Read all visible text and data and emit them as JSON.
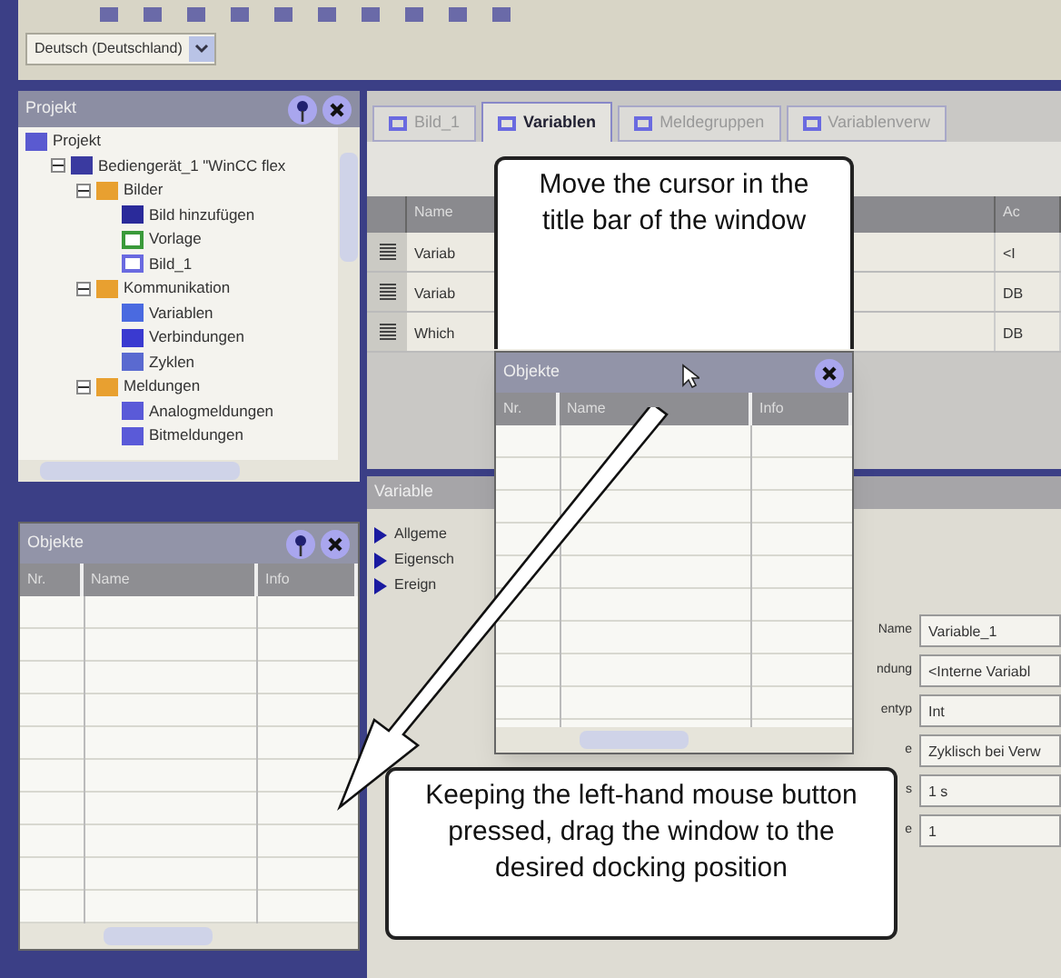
{
  "toolbar": {
    "language": "Deutsch (Deutschland)"
  },
  "project_panel": {
    "title": "Projekt",
    "tree": [
      {
        "label": "Projekt",
        "kind": "root",
        "children": [
          {
            "label": "Bediengerät_1 \"WinCC flex",
            "kind": "device",
            "expanded": true,
            "children": [
              {
                "label": "Bilder",
                "kind": "folder",
                "expanded": true,
                "children": [
                  {
                    "label": "Bild hinzufügen",
                    "kind": "add"
                  },
                  {
                    "label": "Vorlage",
                    "kind": "template"
                  },
                  {
                    "label": "Bild_1",
                    "kind": "screen"
                  }
                ]
              },
              {
                "label": "Kommunikation",
                "kind": "folder",
                "expanded": true,
                "children": [
                  {
                    "label": "Variablen",
                    "kind": "tags"
                  },
                  {
                    "label": "Verbindungen",
                    "kind": "connections"
                  },
                  {
                    "label": "Zyklen",
                    "kind": "cycles"
                  }
                ]
              },
              {
                "label": "Meldungen",
                "kind": "folder",
                "expanded": true,
                "children": [
                  {
                    "label": "Analogmeldungen",
                    "kind": "alarm"
                  },
                  {
                    "label": "Bitmeldungen",
                    "kind": "alarm"
                  }
                ]
              }
            ]
          }
        ]
      }
    ]
  },
  "editor_tabs": [
    {
      "label": "Bild_1",
      "selected": false
    },
    {
      "label": "Variablen",
      "selected": true
    },
    {
      "label": "Meldegruppen",
      "selected": false
    },
    {
      "label": "Variablenverw",
      "selected": false
    }
  ],
  "tags_table": {
    "columns": [
      "Name",
      "Ac"
    ],
    "rows": [
      [
        "Variab",
        "<I"
      ],
      [
        "Variab",
        "DB"
      ],
      [
        "Which",
        "DB"
      ]
    ]
  },
  "properties": {
    "title": "Variable",
    "nav": [
      "Allgeme",
      "Eigensch",
      "Ereign"
    ],
    "fields": [
      {
        "label": "Name",
        "value": "Variable_1"
      },
      {
        "label": "ndung",
        "value": "<Interne Variabl"
      },
      {
        "label": "entyp",
        "value": "Int"
      },
      {
        "label": "e",
        "value": "Zyklisch bei Verw"
      },
      {
        "label": "s",
        "value": "1 s"
      },
      {
        "label": "e",
        "value": "1"
      }
    ]
  },
  "docked_window": {
    "title": "Objekte",
    "columns": [
      "Nr.",
      "Name",
      "Info"
    ]
  },
  "floating_window": {
    "title": "Objekte",
    "columns": [
      "Nr.",
      "Name",
      "Info"
    ]
  },
  "callouts": [
    {
      "text": "Move the cursor in the title bar of the window"
    },
    {
      "text": "Keeping the left-hand mouse button pressed, drag the window to the desired docking position"
    }
  ]
}
